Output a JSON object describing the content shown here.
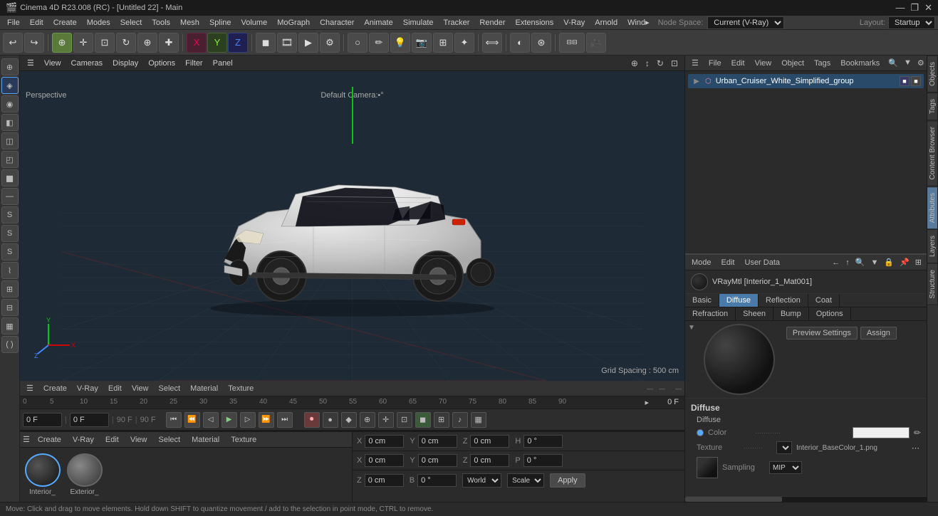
{
  "titlebar": {
    "title": "Cinema 4D R23.008 (RC) - [Untitled 22] - Main",
    "buttons": [
      "—",
      "❐",
      "✕"
    ]
  },
  "menubar": {
    "items": [
      "File",
      "Edit",
      "Create",
      "Modes",
      "Select",
      "Tools",
      "Mesh",
      "Spline",
      "Volume",
      "MoGraph",
      "Character",
      "Animate",
      "Simulate",
      "Tracker",
      "Render",
      "Extensions",
      "V-Ray",
      "Arnold",
      "Wind▸",
      "Node Space:",
      "Current (V-Ray)",
      "Layout:",
      "Startup"
    ]
  },
  "viewport": {
    "label": "Perspective",
    "camera": "Default Camera:•°",
    "grid_spacing": "Grid Spacing : 500 cm",
    "toolbar_items": [
      "View",
      "Cameras",
      "Display",
      "Options",
      "Filter",
      "Panel"
    ]
  },
  "timeline": {
    "frames": [
      "0",
      "5",
      "10",
      "15",
      "20",
      "25",
      "30",
      "35",
      "40",
      "45",
      "50",
      "55",
      "60",
      "65",
      "70",
      "75",
      "80",
      "85",
      "90"
    ],
    "current_frame": "0 F",
    "start_frame": "0 F",
    "end_frame": "90 F",
    "preview_end": "90 F",
    "toolbar": [
      "Create",
      "V-Ray",
      "Edit",
      "View",
      "Select",
      "Material",
      "Texture"
    ]
  },
  "objects_panel": {
    "toolbar": [
      "File",
      "Edit",
      "View",
      "Object",
      "Tags",
      "Bookmarks"
    ],
    "items": [
      {
        "name": "Urban_Cruiser_White_Simplified_group",
        "type": "group",
        "icon": "▶"
      }
    ]
  },
  "attributes_panel": {
    "toolbar": [
      "Mode",
      "Edit",
      "User Data"
    ],
    "material_name": "VRayMtl [Interior_1_Mat001]",
    "tabs_row1": [
      "Basic",
      "Diffuse",
      "Reflection",
      "Coat"
    ],
    "tabs_row2": [
      "Refraction",
      "Sheen",
      "Bump",
      "Options"
    ],
    "active_tab": "Diffuse",
    "preview_buttons": [
      "Preview Settings",
      "Assign"
    ],
    "diffuse": {
      "title": "Diffuse",
      "subtitle": "Diffuse",
      "color_label": "Color",
      "color_dots": "...........",
      "texture_label": "Texture",
      "texture_dots": "..........",
      "texture_value": "Interior_BaseColor_1.png",
      "texture_dropdown": "▾",
      "sampling_label": "Sampling",
      "sampling_value": "MIP",
      "sampling_dropdown": "▾"
    }
  },
  "materials": {
    "items": [
      {
        "name": "Interior_",
        "active": true
      },
      {
        "name": "Exterior_",
        "active": false
      }
    ]
  },
  "coord_bar": {
    "x_pos": "0 cm",
    "y_pos": "0 cm",
    "z_pos": "0 cm",
    "x_scale": "0 cm",
    "y_scale": "0 cm",
    "z_scale": "0 cm",
    "h": "0 °",
    "p": "0 °",
    "b": "0 °",
    "world_label": "World",
    "scale_label": "Scale",
    "apply_label": "Apply"
  },
  "status_bar": {
    "text": "Move: Click and drag to move elements. Hold down SHIFT to quantize movement / add to the selection in point mode, CTRL to remove."
  },
  "right_vtabs": [
    "Objects",
    "Tags",
    "Content Browser",
    "Attributes",
    "Layers",
    "Structure"
  ],
  "playback": {
    "buttons": [
      "⏮",
      "⏪",
      "⏹",
      "▶",
      "⏩",
      "⏭"
    ]
  }
}
